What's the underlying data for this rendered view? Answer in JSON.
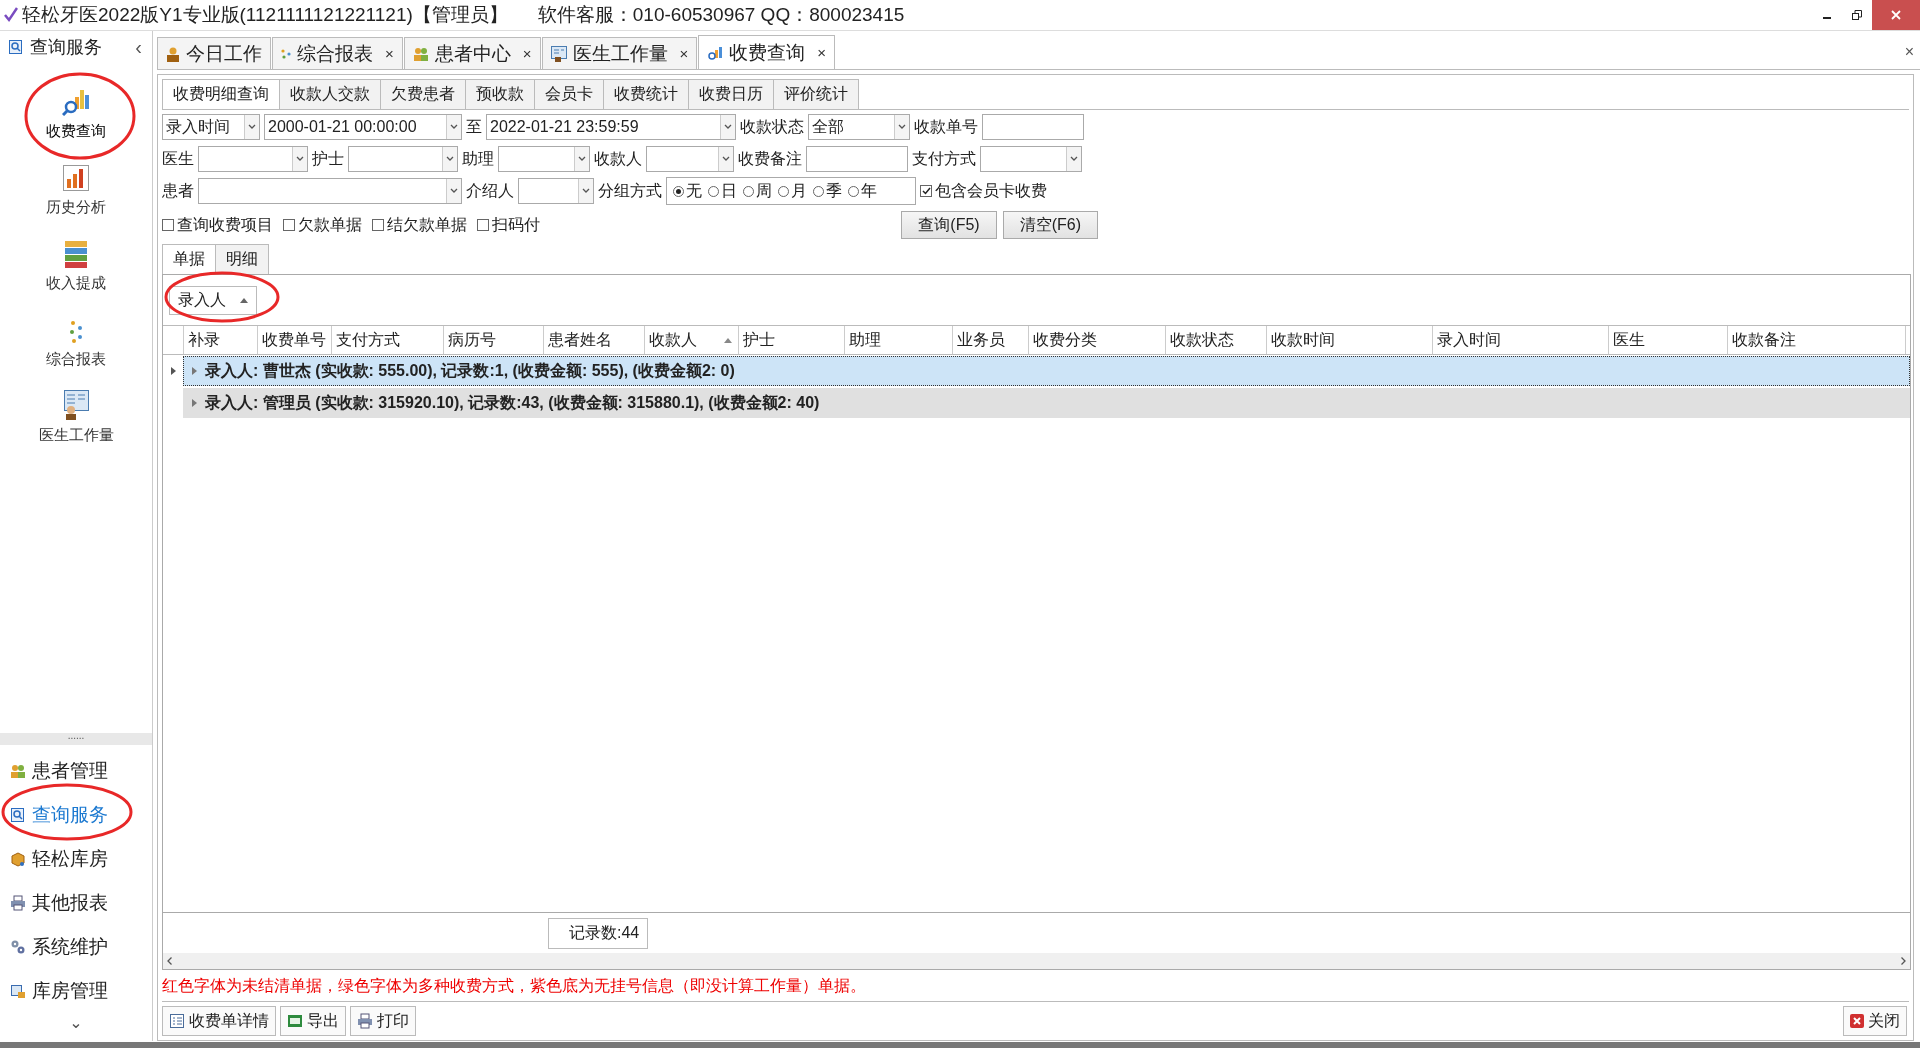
{
  "window": {
    "title": "轻松牙医2022版Y1专业版(1121111121221121)【管理员】",
    "support": "软件客服：010-60530967 QQ：800023415"
  },
  "sidebar": {
    "title": "查询服务",
    "collapse": "‹",
    "items": [
      {
        "label": "收费查询",
        "selected": true
      },
      {
        "label": "历史分析",
        "selected": false
      },
      {
        "label": "收入提成",
        "selected": false
      },
      {
        "label": "综合报表",
        "selected": false
      },
      {
        "label": "医生工作量",
        "selected": false
      }
    ],
    "grip": "......",
    "nav": [
      {
        "label": "患者管理",
        "selected": false
      },
      {
        "label": "查询服务",
        "selected": true
      },
      {
        "label": "轻松库房",
        "selected": false
      },
      {
        "label": "其他报表",
        "selected": false
      },
      {
        "label": "系统维护",
        "selected": false
      },
      {
        "label": "库房管理",
        "selected": false
      }
    ],
    "more": "⌄"
  },
  "doc_tabs": [
    {
      "label": "今日工作",
      "selected": false
    },
    {
      "label": "综合报表",
      "close": "×",
      "selected": false
    },
    {
      "label": "患者中心",
      "close": "×",
      "selected": false
    },
    {
      "label": "医生工作量",
      "close": "×",
      "selected": false
    },
    {
      "label": "收费查询",
      "close": "×",
      "selected": true
    }
  ],
  "close_all": "×",
  "sub_tabs": [
    {
      "label": "收费明细查询",
      "selected": true
    },
    {
      "label": "收款人交款",
      "selected": false
    },
    {
      "label": "欠费患者",
      "selected": false
    },
    {
      "label": "预收款",
      "selected": false
    },
    {
      "label": "会员卡",
      "selected": false
    },
    {
      "label": "收费统计",
      "selected": false
    },
    {
      "label": "收费日历",
      "selected": false
    },
    {
      "label": "评价统计",
      "selected": false
    }
  ],
  "filters": {
    "fields": [
      {
        "kind": "select",
        "value": "录入时间"
      },
      {
        "kind": "select",
        "value": "2000-01-21 00:00:00"
      },
      {
        "label": "至",
        "kind": "select",
        "value": "2022-01-21 23:59:59"
      },
      {
        "label": "收款状态",
        "kind": "select",
        "value": "全部"
      },
      {
        "label": "收款单号",
        "kind": "input"
      },
      {
        "label": "医生",
        "kind": "select"
      },
      {
        "label": "护士",
        "kind": "select"
      },
      {
        "label": "助理",
        "kind": "select"
      },
      {
        "label": "收款人",
        "kind": "select"
      },
      {
        "label": "收费备注",
        "kind": "input"
      },
      {
        "label": "支付方式",
        "kind": "select"
      },
      {
        "label": "患者",
        "kind": "select"
      },
      {
        "label": "介绍人",
        "kind": "select"
      },
      {
        "label": "分组方式",
        "kind": "radios",
        "options": [
          {
            "label": "无",
            "selected": true
          },
          {
            "label": "日",
            "selected": false
          },
          {
            "label": "周",
            "selected": false
          },
          {
            "label": "月",
            "selected": false
          },
          {
            "label": "季",
            "selected": false
          },
          {
            "label": "年",
            "selected": false
          }
        ]
      },
      {
        "kind": "checkbox",
        "text": "包含会员卡收费",
        "checked": true
      }
    ],
    "checks": [
      {
        "label": "查询收费项目",
        "checked": false
      },
      {
        "label": "欠款单据",
        "checked": false
      },
      {
        "label": "结欠款单据",
        "checked": false
      },
      {
        "label": "扫码付",
        "checked": false
      }
    ],
    "buttons": [
      "查询(F5)",
      "清空(F6)"
    ]
  },
  "view_tabs": [
    {
      "label": "单据",
      "selected": true
    },
    {
      "label": "明细",
      "selected": false
    }
  ],
  "table": {
    "group_by": "录入人",
    "columns": [
      {
        "label": "补录",
        "sorted": false
      },
      {
        "label": "收费单号",
        "sorted": false
      },
      {
        "label": "支付方式",
        "sorted": false
      },
      {
        "label": "病历号",
        "sorted": false
      },
      {
        "label": "患者姓名",
        "sorted": false
      },
      {
        "label": "收款人",
        "sorted": true
      },
      {
        "label": "护士",
        "sorted": false
      },
      {
        "label": "助理",
        "sorted": false
      },
      {
        "label": "业务员",
        "sorted": false
      },
      {
        "label": "收费分类",
        "sorted": false
      },
      {
        "label": "收款状态",
        "sorted": false
      },
      {
        "label": "收款时间",
        "sorted": false
      },
      {
        "label": "录入时间",
        "sorted": false
      },
      {
        "label": "医生",
        "sorted": false
      },
      {
        "label": "收款备注",
        "sorted": false
      }
    ],
    "groups": [
      {
        "text": "录入人: 曹世杰 (实收款: 555.00), 记录数:1, (收费金额: 555), (收费金额2: 0)",
        "selected": true
      },
      {
        "text": "录入人: 管理员 (实收款: 315920.10), 记录数:43, (收费金额: 315880.1), (收费金额2: 40)",
        "selected": false
      }
    ],
    "record_count": "记录数:44"
  },
  "note": "红色字体为未结清单据，绿色字体为多种收费方式，紫色底为无挂号信息（即没计算工作量）单据。",
  "toolbar": [
    "收费单详情",
    "导出",
    "打印"
  ],
  "close_button": "关闭"
}
